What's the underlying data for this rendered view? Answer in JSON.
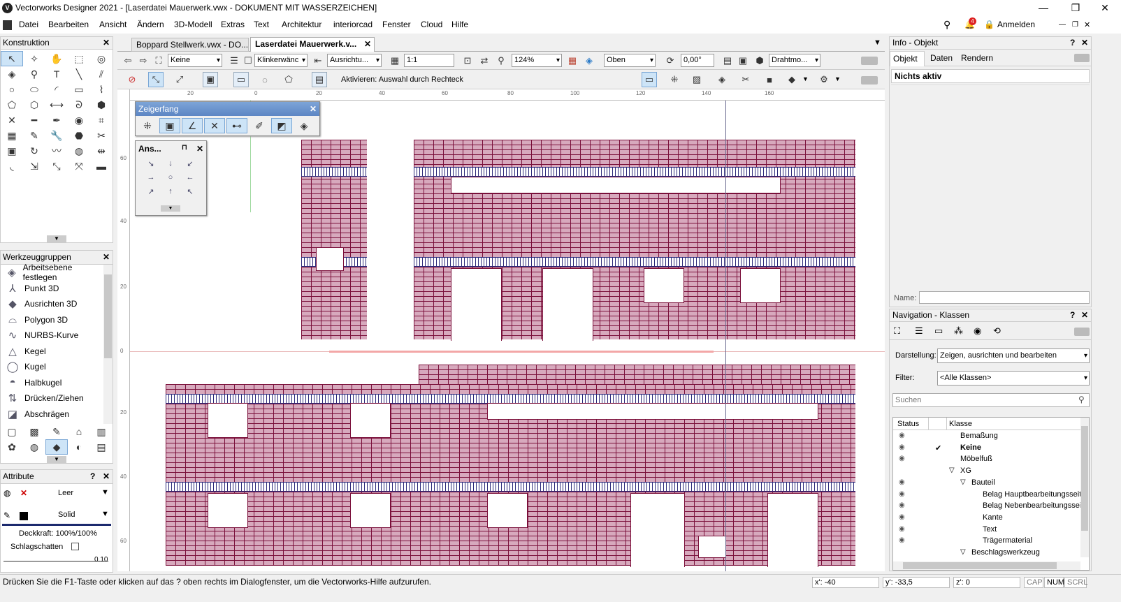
{
  "window": {
    "title": "Vectorworks Designer 2021 - [Laserdatei Mauerwerk.vwx - DOKUMENT MIT WASSERZEICHEN]",
    "app_icon": "V",
    "controls": [
      "—",
      "❐",
      "✕"
    ]
  },
  "menubar": {
    "items": [
      "Datei",
      "Bearbeiten",
      "Ansicht",
      "Ändern",
      "3D-Modell",
      "Extras",
      "Text",
      "Architektur",
      "interiorcad",
      "Fenster",
      "Cloud",
      "Hilfe"
    ],
    "notif_count": "4",
    "signin": "Anmelden"
  },
  "konstruktion": {
    "title": "Konstruktion"
  },
  "werkzeuggruppen": {
    "title": "Werkzeuggruppen",
    "items": [
      "Arbeitsebene festlegen",
      "Punkt 3D",
      "Ausrichten 3D",
      "Polygon 3D",
      "NURBS-Kurve",
      "Kegel",
      "Kugel",
      "Halbkugel",
      "Drücken/Ziehen",
      "Abschrägen"
    ]
  },
  "attribute": {
    "title": "Attribute",
    "fill_value": "Leer",
    "line_value": "Solid",
    "opacity": "Deckkraft: 100%/100%",
    "shadow_label": "Schlagschatten",
    "line_weight": "0.10"
  },
  "tabs": {
    "doc1": "Boppard Stellwerk.vwx - DO...",
    "doc2": "Laserdatei Mauerwerk.v..."
  },
  "viewbar": {
    "layer": "Keine",
    "class": "Klinkerwänc",
    "align": "Ausrichtu...",
    "scale": "1:1",
    "zoom": "124%",
    "view": "Oben",
    "angle": "0,00°",
    "render": "Drahtmo..."
  },
  "modebar": {
    "hint": "Aktivieren: Auswahl durch Rechteck"
  },
  "zeigerfang": {
    "title": "Zeigerfang"
  },
  "ansichten": {
    "title": "Ans..."
  },
  "rulers": {
    "top": [
      "20",
      "0",
      "20",
      "40",
      "60",
      "80",
      "100",
      "120",
      "140",
      "160"
    ],
    "left": [
      "60",
      "40",
      "20",
      "0",
      "20",
      "40",
      "60"
    ]
  },
  "info": {
    "title": "Info - Objekt",
    "tabs": [
      "Objekt",
      "Daten",
      "Rendern"
    ],
    "status": "Nichts aktiv",
    "name_label": "Name:"
  },
  "navigation": {
    "title": "Navigation - Klassen",
    "darstellung_label": "Darstellung:",
    "darstellung_value": "Zeigen, ausrichten und bearbeiten",
    "filter_label": "Filter:",
    "filter_value": "<Alle Klassen>",
    "search_placeholder": "Suchen",
    "col_status": "Status",
    "col_klasse": "Klasse",
    "rows": [
      {
        "name": "Bemaßung",
        "indent": 0,
        "eye": true,
        "check": false,
        "bold": false,
        "toggle": ""
      },
      {
        "name": "Keine",
        "indent": 0,
        "eye": true,
        "check": true,
        "bold": true,
        "toggle": ""
      },
      {
        "name": "Möbelfuß",
        "indent": 0,
        "eye": true,
        "check": false,
        "bold": false,
        "toggle": ""
      },
      {
        "name": "XG",
        "indent": 0,
        "eye": false,
        "check": false,
        "bold": false,
        "toggle": "▽"
      },
      {
        "name": "Bauteil",
        "indent": 1,
        "eye": true,
        "check": false,
        "bold": false,
        "toggle": "▽"
      },
      {
        "name": "Belag Hauptbearbeitungsseit",
        "indent": 2,
        "eye": true,
        "check": false,
        "bold": false,
        "toggle": ""
      },
      {
        "name": "Belag Nebenbearbeitungsseit",
        "indent": 2,
        "eye": true,
        "check": false,
        "bold": false,
        "toggle": ""
      },
      {
        "name": "Kante",
        "indent": 2,
        "eye": true,
        "check": false,
        "bold": false,
        "toggle": ""
      },
      {
        "name": "Text",
        "indent": 2,
        "eye": true,
        "check": false,
        "bold": false,
        "toggle": ""
      },
      {
        "name": "Trägermaterial",
        "indent": 2,
        "eye": true,
        "check": false,
        "bold": false,
        "toggle": ""
      },
      {
        "name": "Beschlagswerkzeug",
        "indent": 1,
        "eye": false,
        "check": false,
        "bold": false,
        "toggle": "▽"
      }
    ]
  },
  "status": {
    "hint": "Drücken Sie die F1-Taste oder klicken auf das ? oben rechts im Dialogfenster, um die Vectorworks-Hilfe aufzurufen.",
    "x": "x': -40",
    "y": "y': -33,5",
    "z": "z': 0",
    "caps": "CAP",
    "num": "NUM",
    "scrl": "SCRL"
  },
  "colors": {
    "brick": "#d7a9bd",
    "mortar": "#7a0f3a",
    "band": "#2c2a7a",
    "accent": "#cde4f7"
  }
}
